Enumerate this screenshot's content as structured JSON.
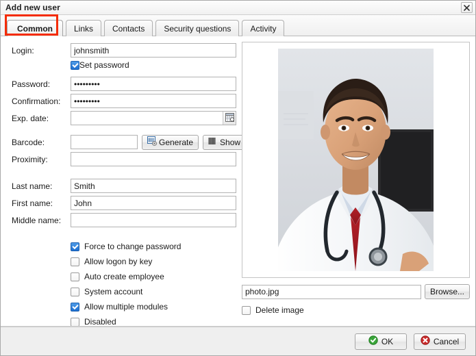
{
  "window": {
    "title": "Add new user",
    "close_icon": "close-icon"
  },
  "tabs": [
    {
      "label": "Common",
      "active": true
    },
    {
      "label": "Links",
      "active": false
    },
    {
      "label": "Contacts",
      "active": false
    },
    {
      "label": "Security questions",
      "active": false
    },
    {
      "label": "Activity",
      "active": false
    }
  ],
  "highlight": {
    "color": "#f42b00",
    "target": "Common"
  },
  "form": {
    "login": {
      "label": "Login:",
      "value": "johnsmith",
      "placeholder": ""
    },
    "set_password": {
      "label": "Set password",
      "checked": true
    },
    "password": {
      "label": "Password:",
      "value": "•••••••••",
      "placeholder": ""
    },
    "confirmation": {
      "label": "Confirmation:",
      "value": "•••••••••",
      "placeholder": ""
    },
    "exp_date": {
      "label": "Exp. date:",
      "value": "",
      "placeholder": "",
      "button_icon": "calendar-icon"
    },
    "barcode": {
      "label": "Barcode:",
      "value": "",
      "placeholder": ""
    },
    "generate_button": {
      "label": "Generate",
      "icon": "barcode-generate-icon"
    },
    "show_button": {
      "label": "Show",
      "icon": "barcode-icon"
    },
    "proximity": {
      "label": "Proximity:",
      "value": "",
      "placeholder": ""
    },
    "last_name": {
      "label": "Last name:",
      "value": "Smith",
      "placeholder": ""
    },
    "first_name": {
      "label": "First name:",
      "value": "John",
      "placeholder": ""
    },
    "middle_name": {
      "label": "Middle name:",
      "value": "",
      "placeholder": ""
    }
  },
  "options": [
    {
      "label": "Force to change password",
      "checked": true
    },
    {
      "label": "Allow logon by key",
      "checked": false
    },
    {
      "label": "Auto create employee",
      "checked": false
    },
    {
      "label": "System account",
      "checked": false
    },
    {
      "label": "Allow multiple modules",
      "checked": true
    },
    {
      "label": "Disabled",
      "checked": false
    }
  ],
  "photo": {
    "alt": "user-photo",
    "file_value": "photo.jpg",
    "file_placeholder": "",
    "browse_label": "Browse...",
    "delete_label": "Delete image",
    "delete_checked": false
  },
  "footer": {
    "ok_label": "OK",
    "cancel_label": "Cancel",
    "ok_color": "#2e9c2e",
    "cancel_color": "#cc2222"
  }
}
